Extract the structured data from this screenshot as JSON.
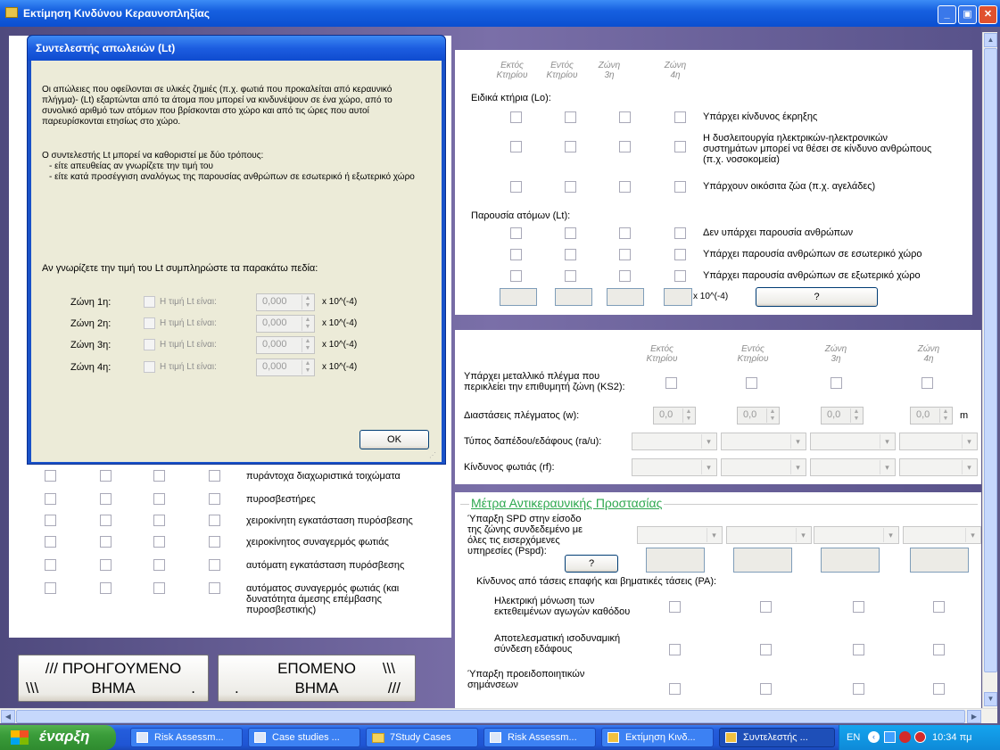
{
  "window": {
    "title": "Εκτίμηση Κινδύνου Κεραυνοπληξίας"
  },
  "zones_short": [
    "Εκτός Κτηρίου",
    "Εντός Κτηρίου",
    "Ζώνη 3η",
    "Ζώνη 4η"
  ],
  "special": {
    "header": "Ειδικά κτήρια (Lo):",
    "items": [
      "Υπάρχει κίνδυνος έκρηξης",
      "Η δυσλειτουργία ηλεκτρικών-ηλεκτρονικών συστημάτων μπορεί να θέσει σε κίνδυνο ανθρώπους (π.χ. νοσοκομεία)",
      "Υπάρχουν οικόσιτα ζώα (π.χ. αγελάδες)"
    ]
  },
  "presence": {
    "header": "Παρουσία ατόμων (Lt):",
    "items": [
      "Δεν υπάρχει παρουσία ανθρώπων",
      "Υπάρχει παρουσία ανθρώπων σε εσωτερικό χώρο",
      "Υπάρχει παρουσία ανθρώπων σε εξωτερικό χώρο"
    ],
    "unit": "x 10^(-4)",
    "btn": "?"
  },
  "grid": {
    "ks2": "Υπάρχει μεταλλικό πλέγμα που περικλείει την επιθυμητή ζώνη (KS2):",
    "w": "Διαστάσεις πλέγματος (w):",
    "w_value": "0,0",
    "w_unit": "m",
    "floor": "Τύπος δαπέδου/εδάφους (ra/u):",
    "fire": "Κίνδυνος φωτιάς (rf):"
  },
  "measures": {
    "title": "Μέτρα Αντικεραυνικής Προστασίας",
    "spd": "Ύπαρξη SPD στην είσοδο της ζώνης συνδεδεμένο με όλες τις εισερχόμενες υπηρεσίες (Pspd):",
    "spd_btn": "?",
    "pa": "Κίνδυνος από τάσεις επαφής και βηματικές τάσεις (PA):",
    "items": [
      "Ηλεκτρική μόνωση των εκτεθειμένων αγωγών καθόδου",
      "Αποτελεσματική ισοδυναμική σύνδεση εδάφους",
      "Ύπαρξη προειδοποιητικών σημάνσεων"
    ]
  },
  "fire_items": [
    "πυράντοχα διαχωριστικά τοιχώματα",
    "πυροσβεστήρες",
    "χειροκίνητη εγκατάσταση πυρόσβεσης",
    "χειροκίνητος συναγερμός φωτιάς",
    "αυτόματη εγκατάσταση πυρόσβεσης",
    "αυτόματος συναγερμός φωτιάς (και δυνατότητα άμεσης επέμβασης πυροσβεστικής)"
  ],
  "nav": {
    "prev_l1": "/// ΠΡΟΗΓΟΥΜΕΝΟ",
    "prev_l2a": "\\\\\\",
    "prev_l2b": "ΒΗΜΑ",
    "prev_l2c": ".",
    "next_l1": "ΕΠΟΜΕΝΟ",
    "next_l1b": "\\\\\\",
    "next_l2a": ".",
    "next_l2b": "ΒΗΜΑ",
    "next_l2c": "///"
  },
  "dialog": {
    "title": "Συντελεστής απωλειών (Lt)",
    "p1": "Οι απώλειες που οφείλονται σε υλικές ζημιές (π.χ. φωτιά που προκαλείται από κεραυνικό πλήγμα)- (Lt) εξαρτώνται από τα άτομα που μπορεί να κινδυνέψουν σε ένα χώρο, από το συνολικό αριθμό των ατόμων που βρίσκονται στο χώρο και από τις ώρες που αυτοί παρευρίσκονται ετησίως στο χώρο.",
    "p2": "Ο συντελεστής Lt μπορεί να καθοριστεί με δύο τρόπους:",
    "p3": "- είτε απευθείας αν γνωρίζετε την τιμή του",
    "p4": "- είτε κατά προσέγγιση αναλόγως της παρουσίας ανθρώπων σε εσωτερικό ή εξωτερικό χώρο",
    "p5": "Αν γνωρίζετε την τιμή του Lt συμπληρώστε τα παρακάτω πεδία:",
    "rows": [
      {
        "zone": "Ζώνη 1η:",
        "check": "Η τιμή Lt είναι:",
        "value": "0,000",
        "unit": "x 10^(-4)"
      },
      {
        "zone": "Ζώνη 2η:",
        "check": "Η τιμή Lt είναι:",
        "value": "0,000",
        "unit": "x 10^(-4)"
      },
      {
        "zone": "Ζώνη 3η:",
        "check": "Η τιμή Lt είναι:",
        "value": "0,000",
        "unit": "x 10^(-4)"
      },
      {
        "zone": "Ζώνη 4η:",
        "check": "Η τιμή Lt είναι:",
        "value": "0,000",
        "unit": "x 10^(-4)"
      }
    ],
    "ok": "OK"
  },
  "taskbar": {
    "start": "έναρξη",
    "tasks": [
      "Risk Assessm...",
      "Case studies ...",
      "7Study Cases",
      "Risk Assessm...",
      "Εκτίμηση Κινδ...",
      "Συντελεστής ..."
    ],
    "lang": "EN",
    "clock": "10:34 πμ"
  }
}
